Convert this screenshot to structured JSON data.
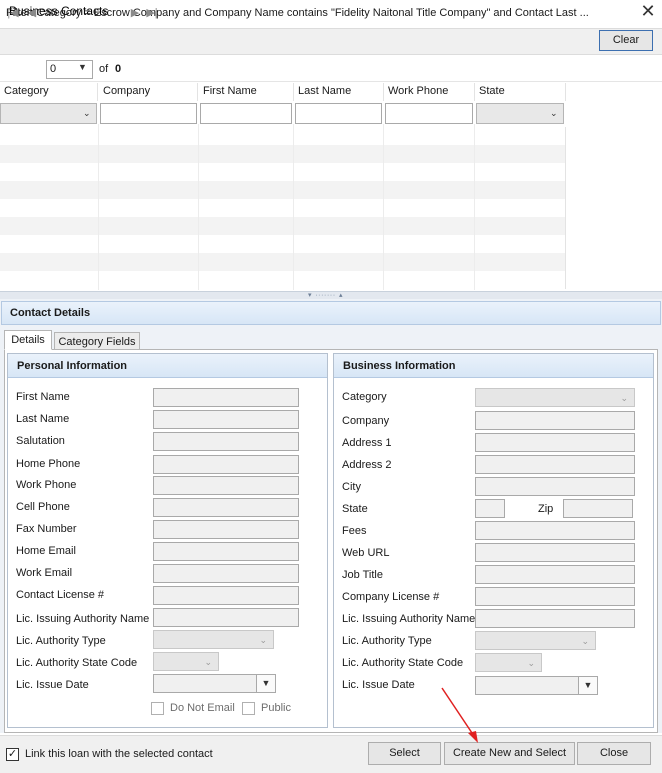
{
  "window": {
    "title": "Business Contacts"
  },
  "filter": {
    "text": "Filter: Category = Escrow Company  and  Company Name contains \"Fidelity Naitonal Title Company\"  and  Contact Last ...",
    "clear_label": "Clear"
  },
  "pager": {
    "page_value": "0",
    "of_label": "of",
    "total": "0"
  },
  "grid": {
    "columns": [
      "Category",
      "Company",
      "First Name",
      "Last Name",
      "Work Phone",
      "State"
    ]
  },
  "details": {
    "title": "Contact Details",
    "tabs": [
      "Details",
      "Category Fields"
    ],
    "personal": {
      "heading": "Personal Information",
      "fields": [
        "First Name",
        "Last Name",
        "Salutation",
        "Home Phone",
        "Work Phone",
        "Cell Phone",
        "Fax Number",
        "Home Email",
        "Work Email",
        "Contact License #",
        "Lic. Issuing Authority Name",
        "Lic. Authority Type",
        "Lic. Authority State Code",
        "Lic. Issue Date"
      ],
      "do_not_email": "Do Not Email",
      "public": "Public"
    },
    "business": {
      "heading": "Business Information",
      "fields": [
        "Category",
        "Company",
        "Address 1",
        "Address 2",
        "City",
        "State",
        "Fees",
        "Web URL",
        "Job Title",
        "Company License #",
        "Lic. Issuing Authority Name",
        "Lic. Authority Type",
        "Lic. Authority State Code",
        "Lic. Issue Date"
      ],
      "zip_label": "Zip"
    }
  },
  "footer": {
    "link_label": "Link this loan with the selected contact",
    "link_checked": true,
    "select_label": "Select",
    "create_label": "Create New and Select",
    "close_label": "Close"
  },
  "colors": {
    "accent": "#3c6fb0",
    "header_bg": "#d7e6f6",
    "annotation_arrow": "#e02020"
  }
}
